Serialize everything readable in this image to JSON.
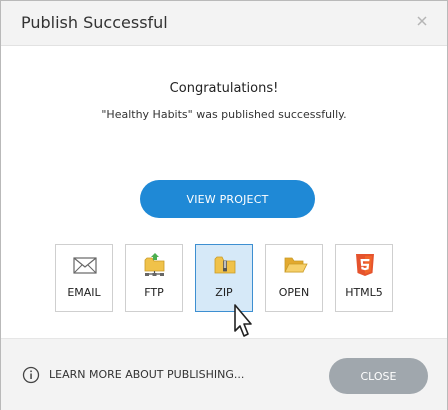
{
  "dialog": {
    "title": "Publish Successful",
    "close_icon": "close-icon"
  },
  "body": {
    "congrats": "Congratulations!",
    "message": "\"Healthy Habits\" was published successfully.",
    "view_project_label": "VIEW PROJECT"
  },
  "tiles": [
    {
      "label": "EMAIL",
      "icon": "envelope-icon"
    },
    {
      "label": "FTP",
      "icon": "ftp-folder-icon"
    },
    {
      "label": "ZIP",
      "icon": "zip-folder-icon",
      "selected": true
    },
    {
      "label": "OPEN",
      "icon": "open-folder-icon"
    },
    {
      "label": "HTML5",
      "icon": "html5-icon"
    }
  ],
  "footer": {
    "learn_more": "LEARN MORE ABOUT PUBLISHING...",
    "close_label": "CLOSE"
  },
  "colors": {
    "primary": "#1f89d6",
    "secondary_button": "#a0a7ad",
    "selected_tile": "#d6e9f8",
    "folder": "#f0c24a",
    "html5": "#e5532d"
  }
}
